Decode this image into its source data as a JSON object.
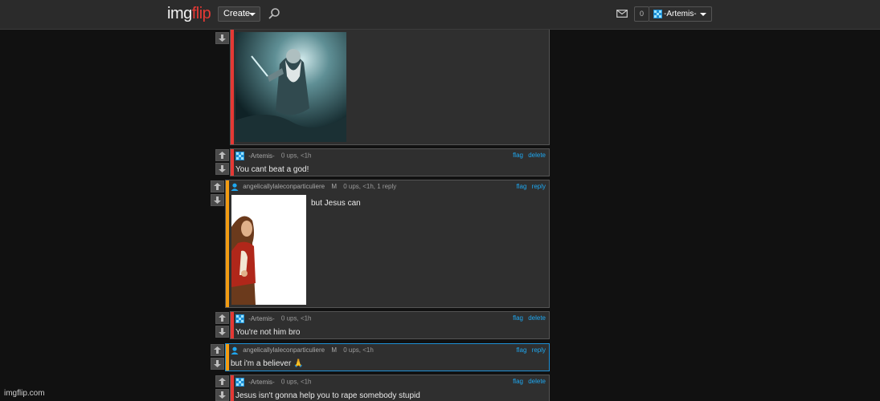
{
  "header": {
    "logo_part1": "img",
    "logo_part2": "flip",
    "create_label": "Create",
    "notification_count": "0",
    "username": "-Artemis-"
  },
  "comments": [
    {
      "username": "-Artemis-",
      "upvotes": "0 ups, <1h",
      "text": "You cant beat a god!",
      "actions": [
        "flag",
        "delete"
      ]
    },
    {
      "username": "angelicallylaleconparticuliere",
      "flair": "M",
      "upvotes": "0 ups, <1h, 1 reply",
      "text": "but Jesus can",
      "actions": [
        "flag",
        "reply"
      ]
    },
    {
      "username": "-Artemis-",
      "upvotes": "0 ups, <1h",
      "text": "You're not him bro",
      "actions": [
        "flag",
        "delete"
      ]
    },
    {
      "username": "angelicallylaleconparticuliere",
      "flair": "M",
      "upvotes": "0 ups, <1h",
      "text": "but i'm a believer 🙏",
      "actions": [
        "flag",
        "reply"
      ]
    },
    {
      "username": "-Artemis-",
      "upvotes": "0 ups, <1h",
      "text": "Jesus isn't gonna help you to rape somebody stupid",
      "actions": [
        "flag",
        "delete"
      ]
    }
  ],
  "footer": {
    "watermark": "imgflip.com"
  },
  "colors": {
    "accent_red": "#e53935",
    "accent_orange": "#f39c12",
    "link_blue": "#1ea7f0"
  }
}
